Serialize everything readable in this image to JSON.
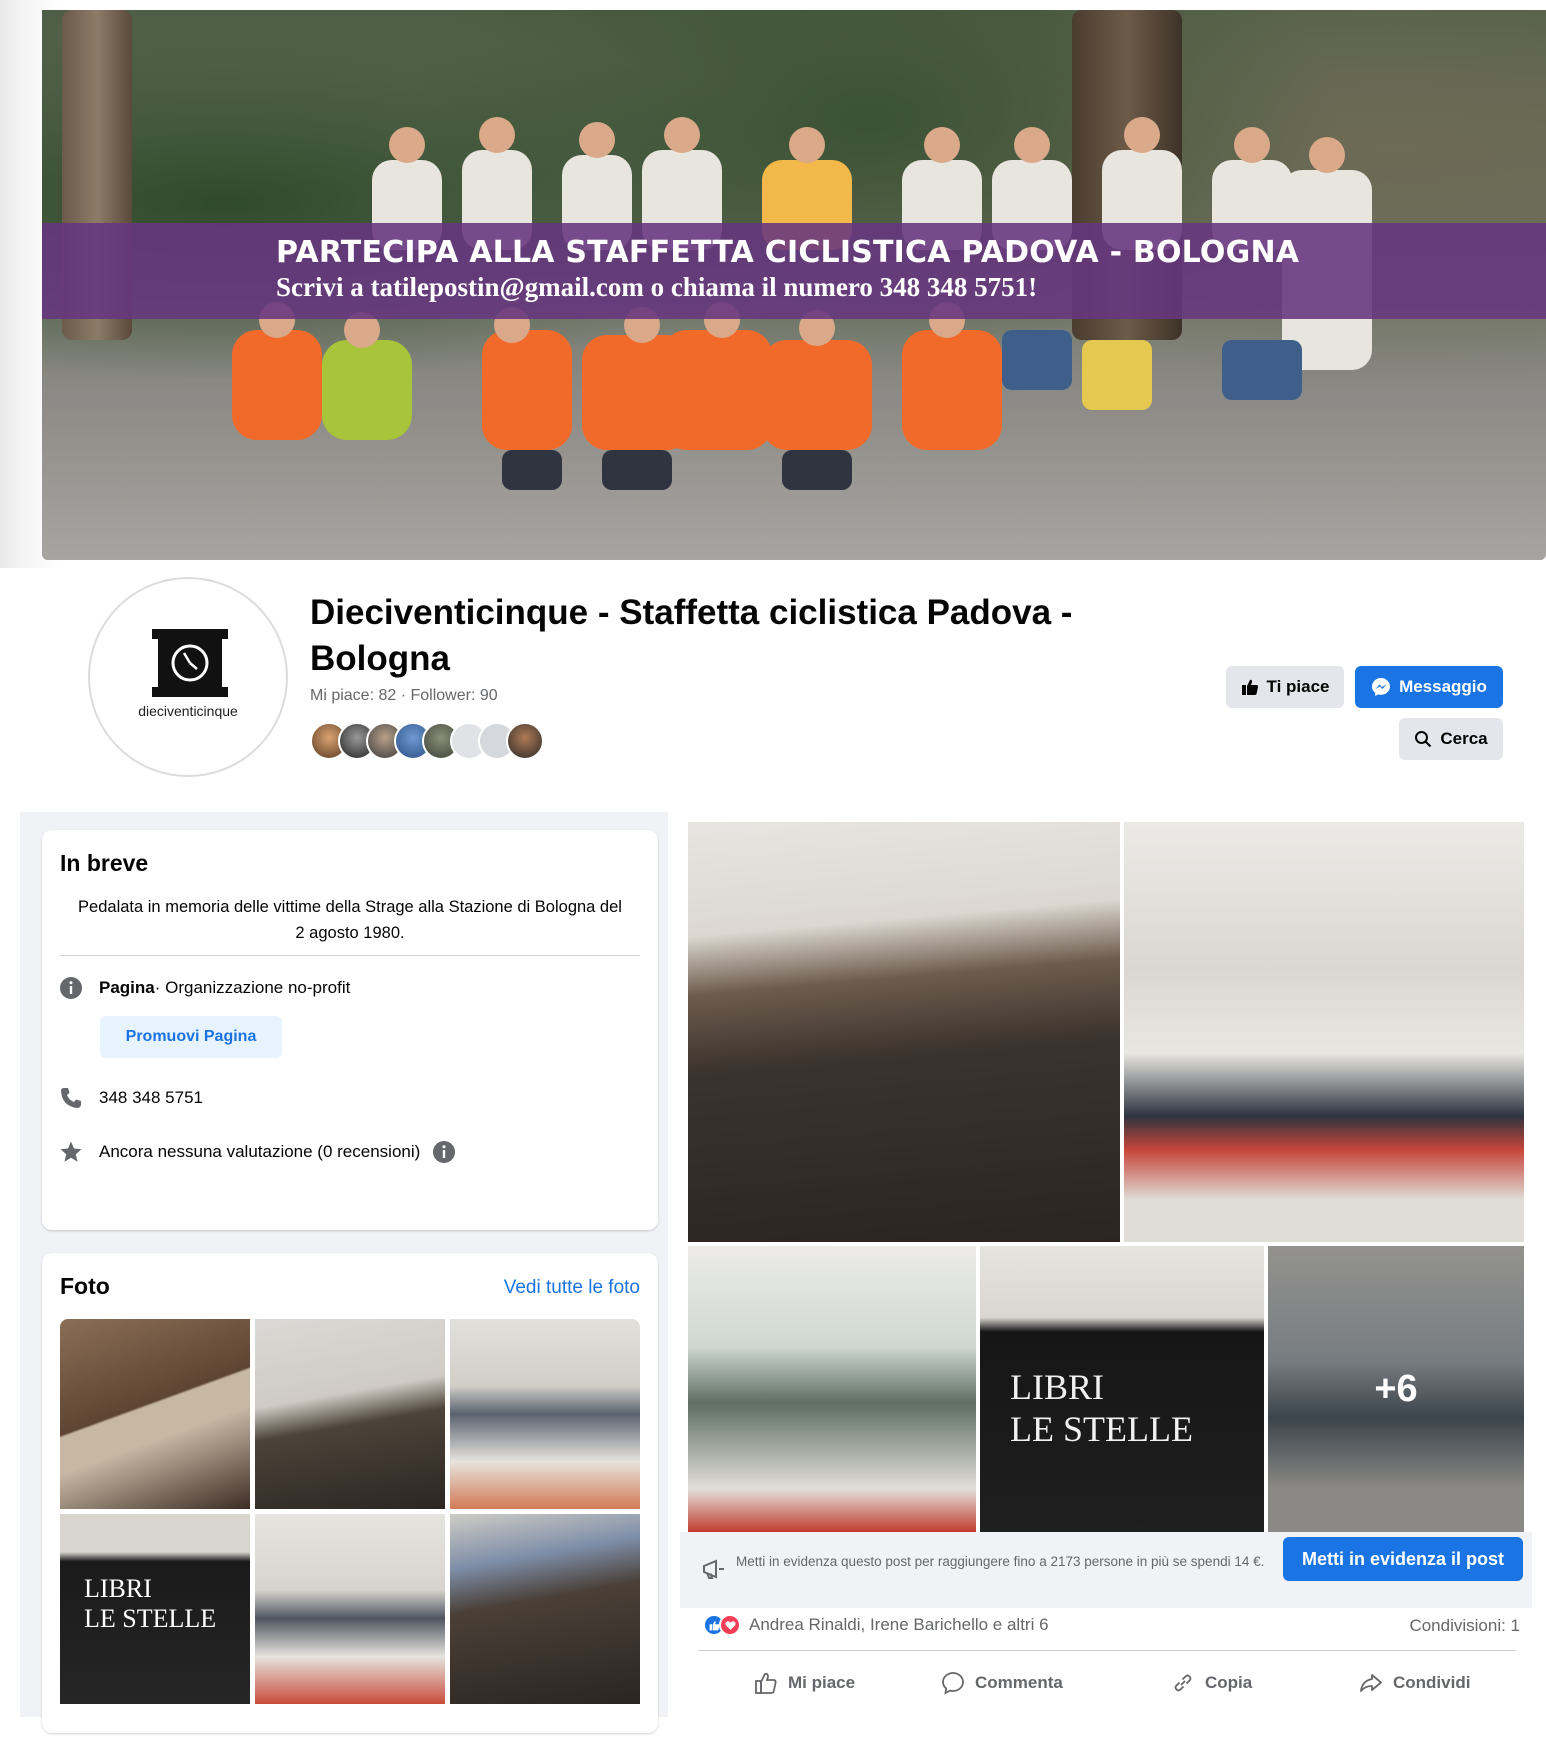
{
  "cover": {
    "banner_title": "PARTECIPA ALLA STAFFETTA CICLISTICA PADOVA - BOLOGNA",
    "banner_subtitle": "Scrivi a tatilepostin@gmail.com o chiama il numero 348 348 5751!"
  },
  "profile": {
    "avatar_text": "dieciventicinque",
    "page_name": "Dieciventicinque - Staffetta ciclistica Padova - Bologna",
    "stats": "Mi piace: 82 · Follower: 90"
  },
  "actions": {
    "like_label": "Ti piace",
    "message_label": "Messaggio",
    "search_label": "Cerca"
  },
  "intro": {
    "title": "In breve",
    "description": "Pedalata in memoria delle vittime della Strage alla Stazione di Bologna del 2 agosto 1980.",
    "page_type_label": "Pagina",
    "page_type_value": " · Organizzazione no-profit",
    "promote_label": "Promuovi Pagina",
    "phone": "348 348 5751",
    "rating": "Ancora nessuna valutazione (0 recensioni)"
  },
  "photos": {
    "title": "Foto",
    "see_all": "Vedi tutte le foto"
  },
  "post": {
    "more_count": "+6",
    "boost_text": "Metti in evidenza questo post per raggiungere fino a 2173 persone in più se spendi 14 €.",
    "boost_button": "Metti in evidenza il post",
    "reactions_text": "Andrea Rinaldi, Irene Barichello e altri 6",
    "shares_text": "Condivisioni: 1",
    "action_like": "Mi piace",
    "action_comment": "Commenta",
    "action_copy": "Copia",
    "action_share": "Condividi"
  },
  "colors": {
    "primary": "#1b74e4",
    "banner": "#663680",
    "secondary_text": "#65676b"
  }
}
